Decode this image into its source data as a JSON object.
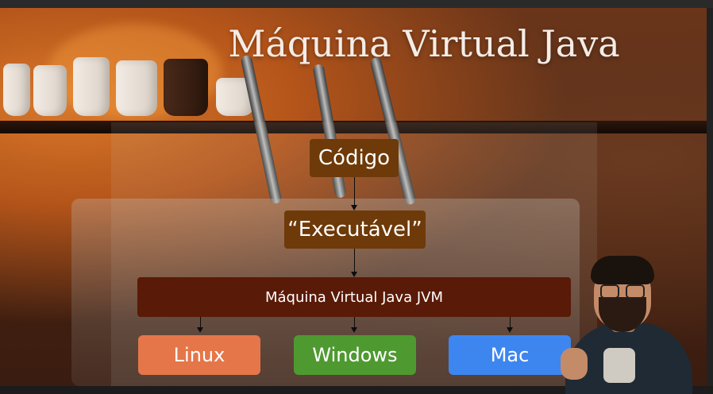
{
  "slide": {
    "title": "Máquina Virtual Java",
    "diagram": {
      "source": "Código",
      "executable": "“Executável”",
      "jvm": "Máquina Virtual Java  JVM",
      "targets": [
        "Linux",
        "Windows",
        "Mac"
      ]
    }
  },
  "colors": {
    "box_brown": "#6e3a09",
    "jvm_bar": "#5a1a08",
    "linux": "#e5764a",
    "windows": "#4e9a30",
    "mac": "#3d86f0"
  }
}
